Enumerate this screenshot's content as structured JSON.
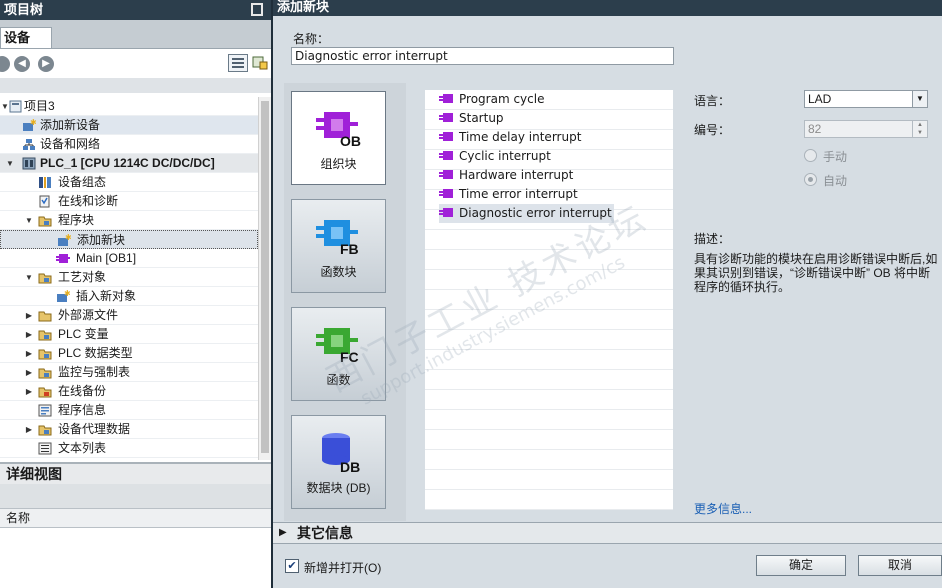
{
  "project_tree": {
    "title": "项目树",
    "tab": "设备",
    "items": [
      {
        "label": "项目3",
        "level": 0,
        "icon": "project-icon",
        "toggle": "expanded"
      },
      {
        "label": "添加新设备",
        "level": 1,
        "icon": "add-device-icon",
        "toggle": "none"
      },
      {
        "label": "设备和网络",
        "level": 1,
        "icon": "network-icon",
        "toggle": "none"
      },
      {
        "label": "PLC_1 [CPU 1214C DC/DC/DC]",
        "level": 1,
        "icon": "plc-icon",
        "toggle": "expanded"
      },
      {
        "label": "设备组态",
        "level": 2,
        "icon": "device-config-icon",
        "toggle": "none"
      },
      {
        "label": "在线和诊断",
        "level": 2,
        "icon": "online-diagnostics-icon",
        "toggle": "none"
      },
      {
        "label": "程序块",
        "level": 2,
        "icon": "folder-icon",
        "toggle": "expanded"
      },
      {
        "label": "添加新块",
        "level": 3,
        "icon": "add-block-icon",
        "toggle": "none"
      },
      {
        "label": "Main [OB1]",
        "level": 3,
        "icon": "ob-block-icon",
        "toggle": "none"
      },
      {
        "label": "工艺对象",
        "level": 2,
        "icon": "folder-icon",
        "toggle": "expanded"
      },
      {
        "label": "插入新对象",
        "level": 3,
        "icon": "add-object-icon",
        "toggle": "none"
      },
      {
        "label": "外部源文件",
        "level": 2,
        "icon": "folder-icon",
        "toggle": "collapsed"
      },
      {
        "label": "PLC 变量",
        "level": 2,
        "icon": "folder-icon",
        "toggle": "collapsed"
      },
      {
        "label": "PLC 数据类型",
        "level": 2,
        "icon": "folder-icon",
        "toggle": "collapsed"
      },
      {
        "label": "监控与强制表",
        "level": 2,
        "icon": "folder-icon",
        "toggle": "collapsed"
      },
      {
        "label": "在线备份",
        "level": 2,
        "icon": "folder-icon",
        "toggle": "collapsed"
      },
      {
        "label": "程序信息",
        "level": 2,
        "icon": "program-info-icon",
        "toggle": "none"
      },
      {
        "label": "设备代理数据",
        "level": 2,
        "icon": "folder-icon",
        "toggle": "collapsed"
      },
      {
        "label": "文本列表",
        "level": 2,
        "icon": "text-list-icon",
        "toggle": "none"
      }
    ],
    "details_title": "详细视图",
    "details_column": "名称"
  },
  "dialog": {
    "title": "添加新块",
    "name_label": "名称：",
    "name_value": "Diagnostic error interrupt",
    "block_types": [
      {
        "label": "组织块",
        "code": "OB",
        "color": "#a020d8"
      },
      {
        "label": "函数块",
        "code": "FB",
        "color": "#1f8fe0"
      },
      {
        "label": "函数",
        "code": "FC",
        "color": "#3aa832"
      },
      {
        "label": "数据块 (DB)",
        "code": "DB",
        "color": "#3a4fd8"
      }
    ],
    "ob_list": [
      "Program cycle",
      "Startup",
      "Time delay interrupt",
      "Cyclic interrupt",
      "Hardware interrupt",
      "Time error interrupt",
      "Diagnostic error interrupt"
    ],
    "language_label": "语言：",
    "language_value": "LAD",
    "number_label": "编号：",
    "number_value": "82",
    "manual_label": "手动",
    "auto_label": "自动",
    "description_label": "描述：",
    "description_text": "具有诊断功能的模块在启用诊断错误中断后,如果其识别到错误，“诊断错误中断” OB 将中断程序的循环执行。",
    "more_info": "更多信息...",
    "other_info": "其它信息",
    "add_and_open": "新增并打开(O)",
    "ok": "确定",
    "cancel": "取消"
  },
  "watermark": {
    "line1": "西门子工业 技术论坛",
    "line2": "support.industry.siemens.com/cs"
  }
}
